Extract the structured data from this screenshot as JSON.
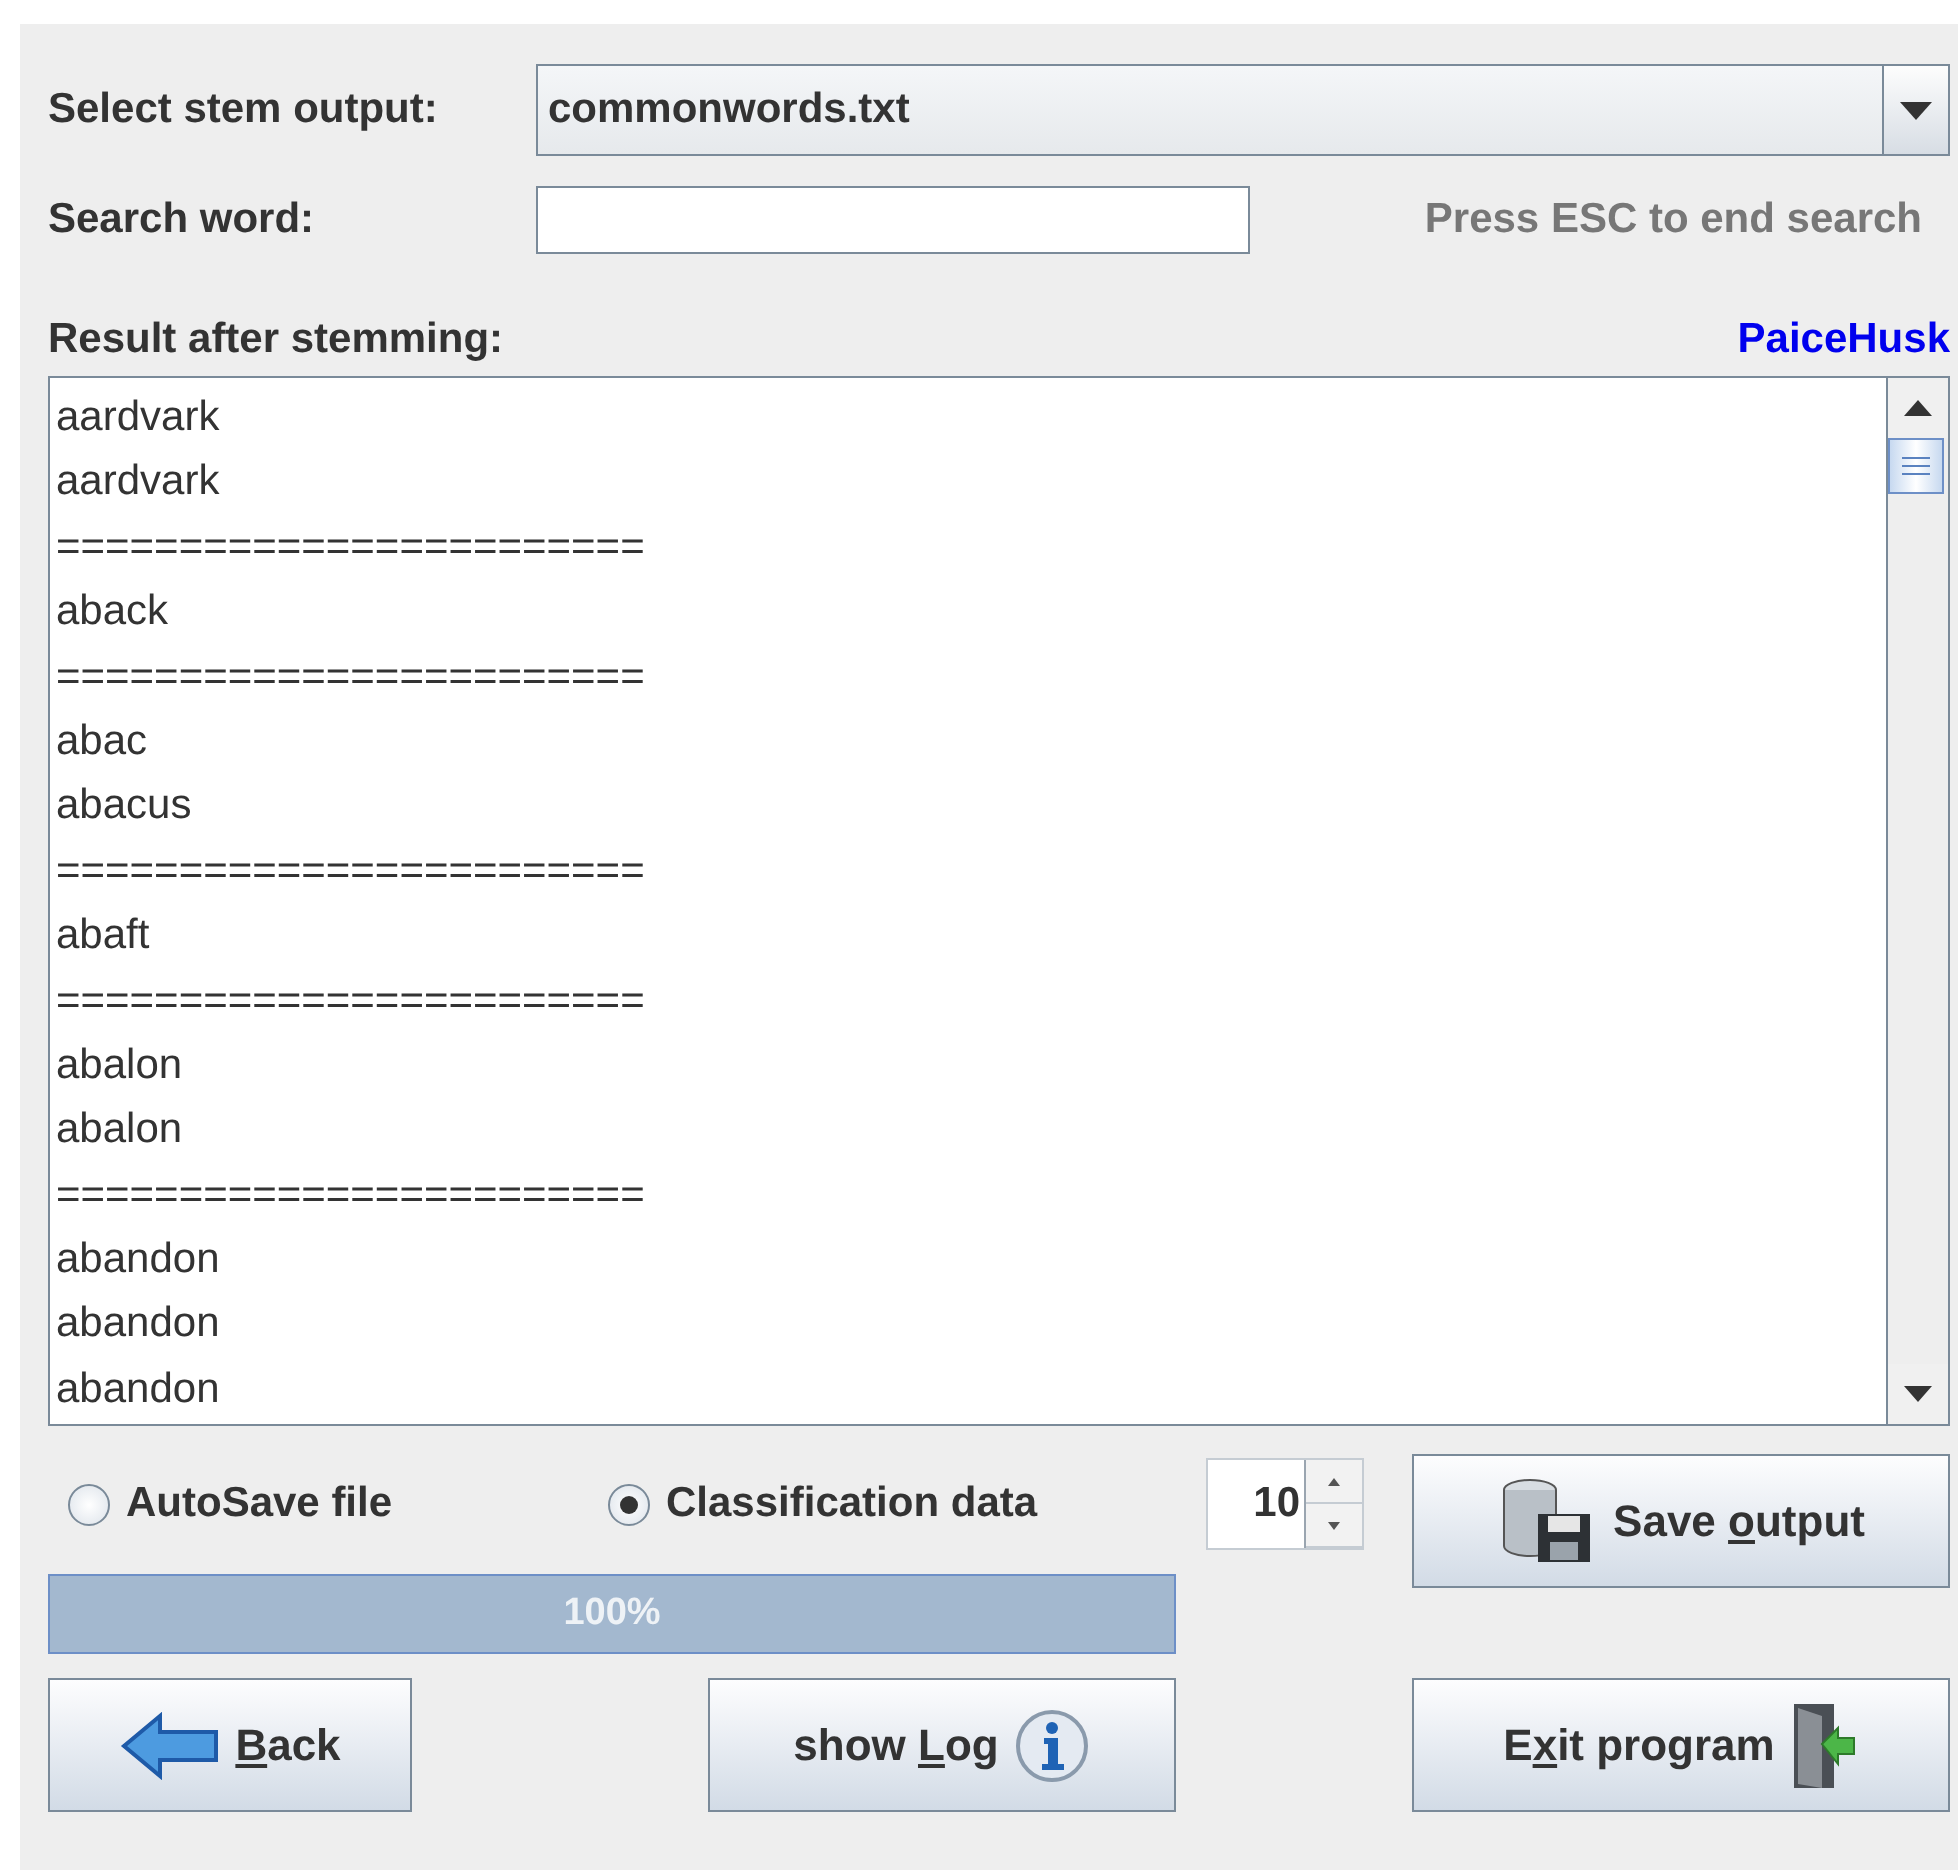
{
  "stem_output": {
    "label": "Select stem output:",
    "value": "commonwords.txt"
  },
  "search": {
    "label": "Search word:",
    "hint": "Press ESC to end search"
  },
  "result": {
    "label": "Result after stemming:",
    "link": "PaiceHusk",
    "lines": [
      "aardvark",
      "aardvark",
      "========================",
      "aback",
      "========================",
      "abac",
      "abacus",
      "========================",
      "abaft",
      "========================",
      "abalon",
      "abalon",
      "========================",
      "abandon",
      "abandon",
      "abandon"
    ]
  },
  "options": [
    {
      "label": "AutoSave file",
      "selected": false
    },
    {
      "label": "Classification data",
      "selected": true
    }
  ],
  "spinner": {
    "value": "10"
  },
  "progress": {
    "level": 1.0,
    "text": "100%"
  },
  "buttons": [
    {
      "kind": "save",
      "before": "Save ",
      "key": "o",
      "after": "utput"
    },
    {
      "kind": "back",
      "key": "B",
      "after": "ack"
    },
    {
      "kind": "log",
      "before": "show ",
      "key": "L",
      "after": "og"
    },
    {
      "kind": "exit",
      "before": "E",
      "key": "x",
      "after": "it program"
    }
  ]
}
